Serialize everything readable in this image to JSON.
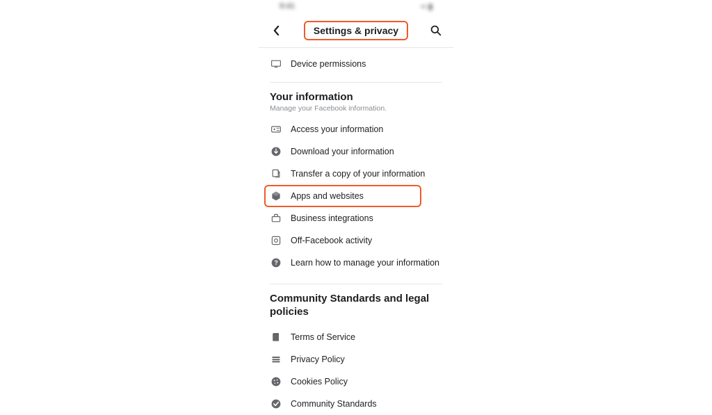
{
  "header": {
    "title": "Settings & privacy"
  },
  "top_items": [
    {
      "label": "Device permissions",
      "icon": "device-icon"
    }
  ],
  "sections": {
    "your_information": {
      "title": "Your information",
      "subtitle": "Manage your Facebook information.",
      "items": [
        {
          "label": "Access your information",
          "icon": "access-icon"
        },
        {
          "label": "Download your information",
          "icon": "download-icon"
        },
        {
          "label": "Transfer a copy of your information",
          "icon": "transfer-icon"
        },
        {
          "label": "Apps and websites",
          "icon": "apps-icon",
          "highlight": true
        },
        {
          "label": "Business integrations",
          "icon": "business-icon"
        },
        {
          "label": "Off-Facebook activity",
          "icon": "activity-icon"
        },
        {
          "label": "Learn how to manage your information",
          "icon": "help-icon"
        }
      ]
    },
    "community": {
      "title": "Community Standards and legal policies",
      "items": [
        {
          "label": "Terms of Service",
          "icon": "terms-icon"
        },
        {
          "label": "Privacy Policy",
          "icon": "privacy-icon"
        },
        {
          "label": "Cookies Policy",
          "icon": "cookies-icon"
        },
        {
          "label": "Community Standards",
          "icon": "community-icon"
        }
      ]
    }
  }
}
